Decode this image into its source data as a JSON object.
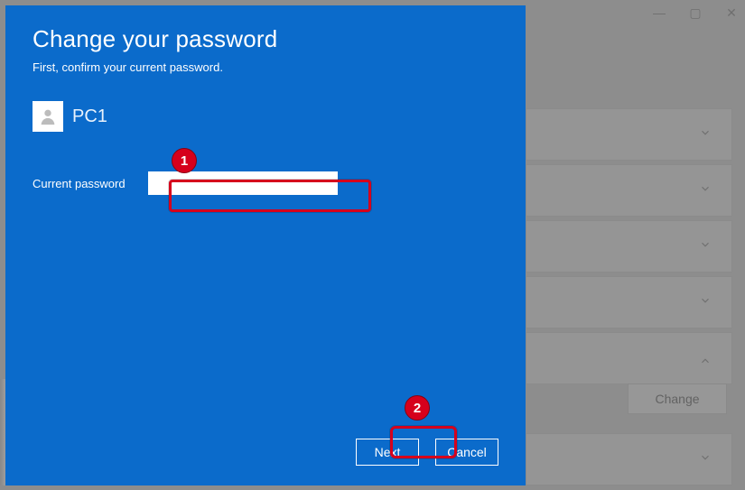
{
  "window_controls": {
    "minimize": "—",
    "maximize": "▢",
    "close": "✕"
  },
  "background": {
    "change_button": "Change"
  },
  "modal": {
    "title": "Change your password",
    "subtitle": "First, confirm your current password.",
    "user": {
      "name": "PC1"
    },
    "form": {
      "current_password_label": "Current password",
      "current_password_value": ""
    },
    "buttons": {
      "next": "Next",
      "cancel": "Cancel"
    }
  },
  "annotations": {
    "badge1": "1",
    "badge2": "2"
  }
}
